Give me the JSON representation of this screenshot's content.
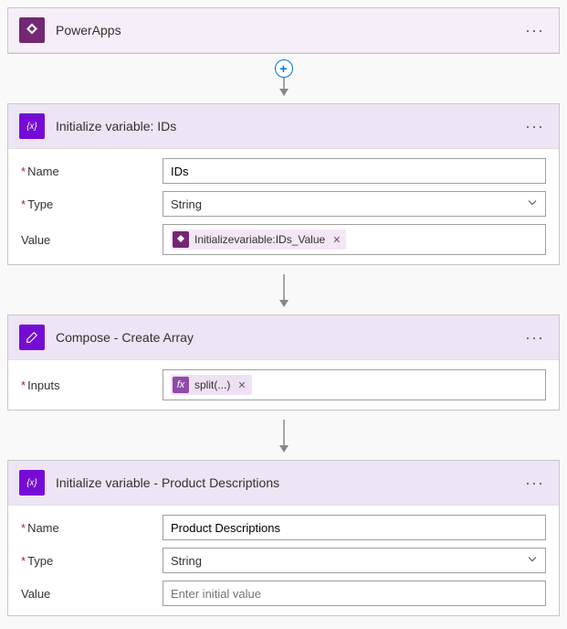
{
  "steps": {
    "powerapps": {
      "title": "PowerApps"
    },
    "initIds": {
      "title": "Initialize variable: IDs",
      "nameLabel": "Name",
      "typeLabel": "Type",
      "valueLabel": "Value",
      "nameValue": "IDs",
      "typeValue": "String",
      "tokenText": "Initializevariable:IDs_Value"
    },
    "compose": {
      "title": "Compose - Create Array",
      "inputsLabel": "Inputs",
      "tokenText": "split(...)"
    },
    "initDesc": {
      "title": "Initialize variable - Product Descriptions",
      "nameLabel": "Name",
      "typeLabel": "Type",
      "valueLabel": "Value",
      "nameValue": "Product Descriptions",
      "typeValue": "String",
      "valuePlaceholder": "Enter initial value"
    }
  },
  "icons": {
    "fx": "fx"
  }
}
